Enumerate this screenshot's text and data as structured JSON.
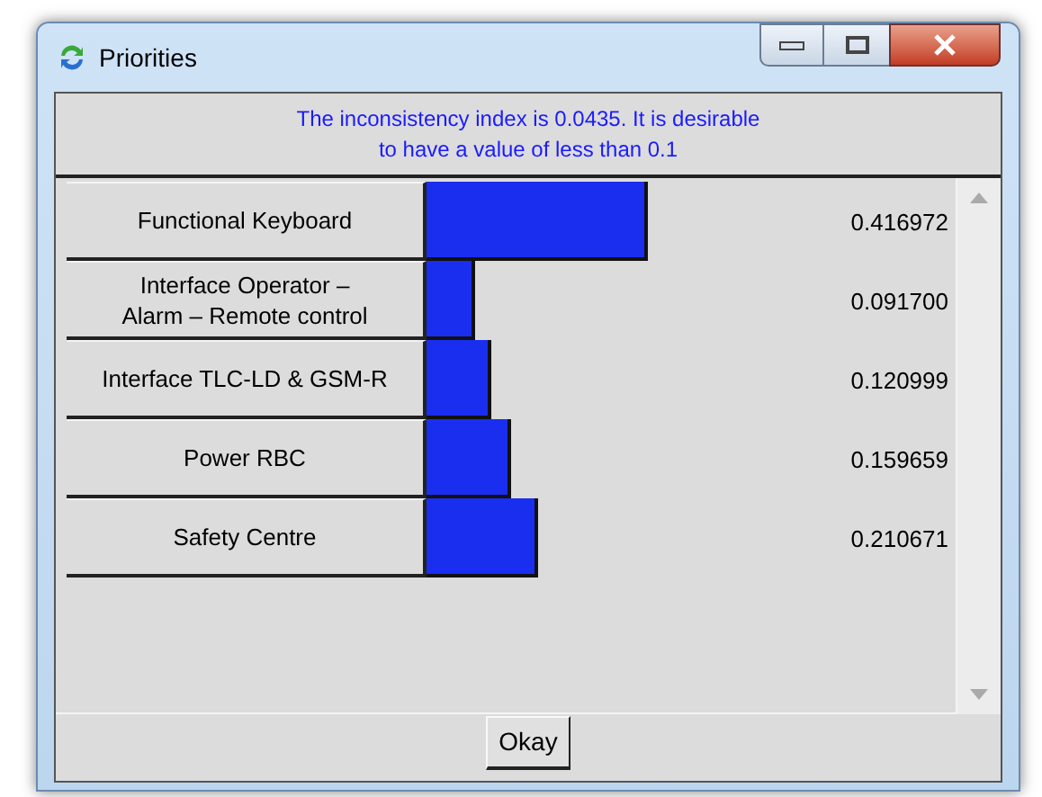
{
  "window": {
    "title": "Priorities"
  },
  "message": "The inconsistency index is 0.0435.  It is desirable to have a value of less than 0.1",
  "priorities": [
    {
      "label": "Functional Keyboard",
      "value": "0.416972"
    },
    {
      "label": "Interface Operator –\nAlarm – Remote control",
      "value": "0.091700"
    },
    {
      "label": "Interface TLC-LD & GSM-R",
      "value": "0.120999"
    },
    {
      "label": "Power RBC",
      "value": "0.159659"
    },
    {
      "label": "Safety Centre",
      "value": "0.210671"
    }
  ],
  "buttons": [
    "Okay"
  ]
}
